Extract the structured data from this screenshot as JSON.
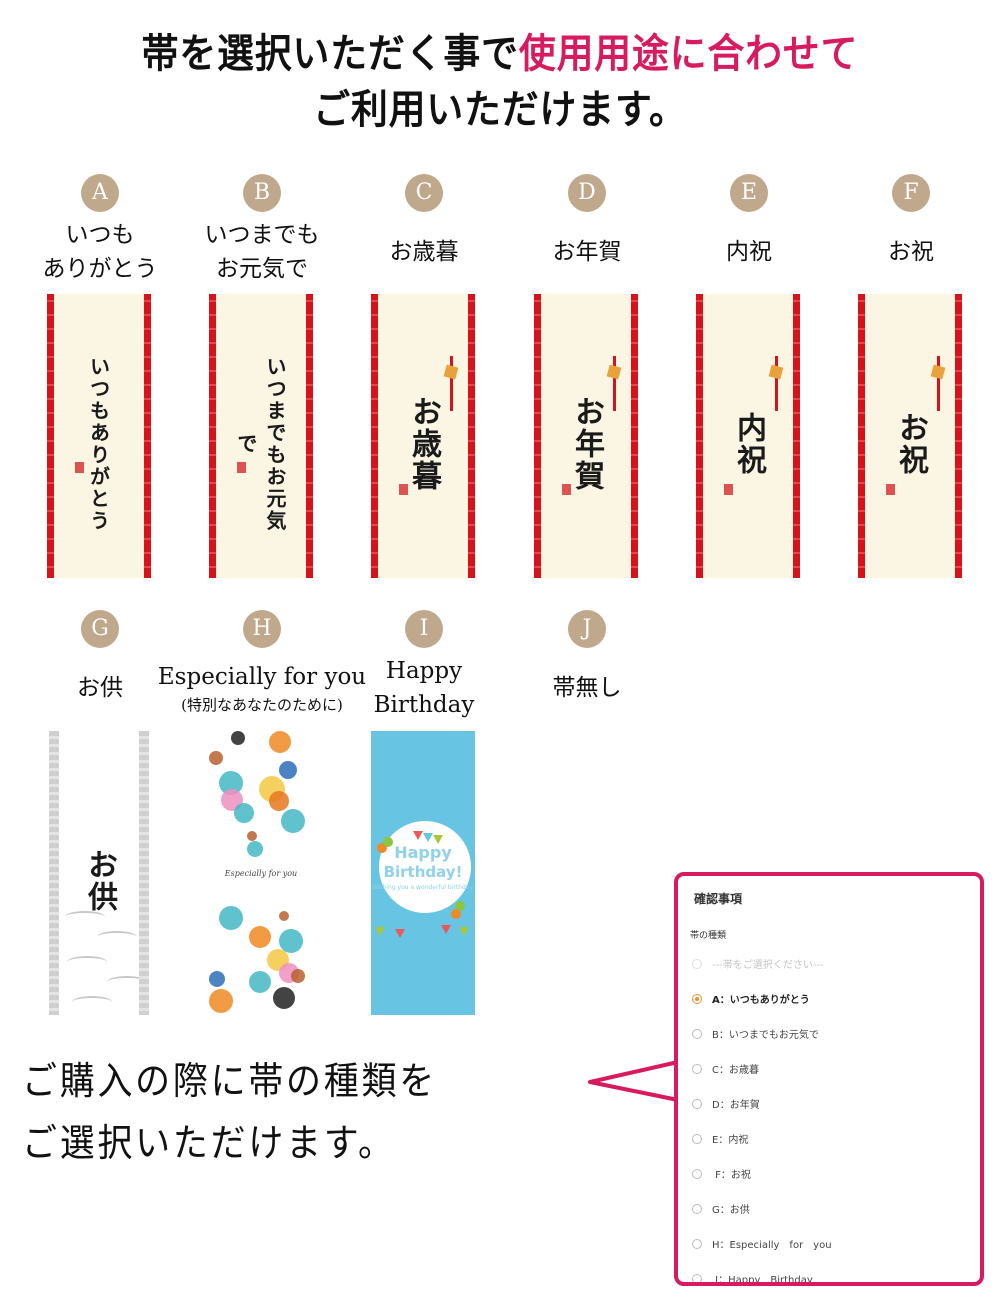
{
  "headline": {
    "line1_plain": "帯を選択いただく事で",
    "line1_accent": "使用用途に合わせて",
    "line2": "ご利用いただけます。",
    "accent_color": "#d81b60"
  },
  "items": [
    {
      "letter": "A",
      "label_lines": [
        "いつも",
        "ありがとう"
      ],
      "band_text": "いつもありがとう",
      "style": "red"
    },
    {
      "letter": "B",
      "label_lines": [
        "いつまでも",
        "お元気で"
      ],
      "band_text": "いつまでもお元気で",
      "style": "red"
    },
    {
      "letter": "C",
      "label_lines": [
        "お歳暮"
      ],
      "band_text": "お歳暮",
      "style": "red"
    },
    {
      "letter": "D",
      "label_lines": [
        "お年賀"
      ],
      "band_text": "お年賀",
      "style": "red"
    },
    {
      "letter": "E",
      "label_lines": [
        "内祝"
      ],
      "band_text": "内祝",
      "style": "red"
    },
    {
      "letter": "F",
      "label_lines": [
        "お祝"
      ],
      "band_text": "お祝",
      "style": "red"
    },
    {
      "letter": "G",
      "label_lines": [
        "お供"
      ],
      "band_text": "お供",
      "style": "gray"
    },
    {
      "letter": "H",
      "label_lines": [
        "Especially for you",
        "(特別なあなたのために)"
      ],
      "band_text": "Especially for you",
      "style": "pattern"
    },
    {
      "letter": "I",
      "label_lines": [
        "Happy",
        "Birthday"
      ],
      "band_text": "Happy Birthday!",
      "band_subtext": "Wishing you a wonderful birthday.",
      "style": "birthday"
    },
    {
      "letter": "J",
      "label_lines": [
        "帯無し"
      ],
      "style": "none"
    }
  ],
  "bottom_text": {
    "line1": "ご購入の際に帯の種類を",
    "line2": "ご選択いただけます。"
  },
  "callout_panel": {
    "title": "確認事項",
    "field_label": "帯の種類",
    "placeholder_option": "---帯をご選択ください---",
    "options": [
      {
        "label": "A：いつもありがとう",
        "selected": true
      },
      {
        "label": "B：いつまでもお元気で",
        "selected": false
      },
      {
        "label": "C：お歳暮",
        "selected": false
      },
      {
        "label": "D：お年賀",
        "selected": false
      },
      {
        "label": "E：内祝",
        "selected": false
      },
      {
        "label": " F：お祝",
        "selected": false
      },
      {
        "label": "G：お供",
        "selected": false
      },
      {
        "label": "H：Especially　for　you",
        "selected": false
      },
      {
        "label": " I：Happy　Birthday",
        "selected": false
      }
    ],
    "border_color": "#d81b60",
    "selected_color": "#f0902c"
  },
  "badge_color": "#bfa88c"
}
